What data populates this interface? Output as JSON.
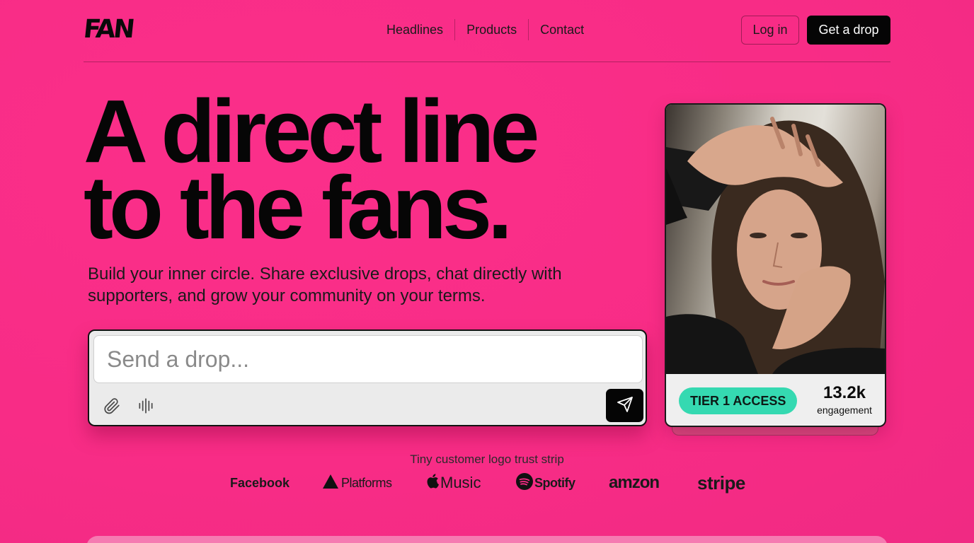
{
  "brand": {
    "logo_text": "FAN"
  },
  "nav": {
    "items": [
      {
        "label": "Headlines"
      },
      {
        "label": "Products"
      },
      {
        "label": "Contact"
      }
    ],
    "login_label": "Log in",
    "cta_label": "Get a drop"
  },
  "hero": {
    "headline_line1": "A direct line",
    "headline_line2": "to the fans.",
    "subtext": "Build your inner circle. Share exclusive drops, chat directly with supporters, and grow your community on your terms."
  },
  "composer": {
    "placeholder": "Send a drop...",
    "value": "",
    "icons": [
      "paperclip-icon",
      "waveform-icon",
      "send-icon"
    ]
  },
  "profile_card": {
    "tier_badge": "TIER 1 ACCESS",
    "engagement_value": "13.2k",
    "engagement_label": "engagement"
  },
  "trust_strip": {
    "caption": "Tiny customer logo trust strip",
    "logos": [
      {
        "name": "Facebook",
        "icon": ""
      },
      {
        "name": "Platforms",
        "icon": "triangle-icon"
      },
      {
        "name": "Music",
        "icon": "apple-icon"
      },
      {
        "name": "Spotify",
        "icon": "spotify-icon"
      },
      {
        "name": "amzon",
        "icon": ""
      },
      {
        "name": "stripe",
        "icon": ""
      }
    ]
  },
  "colors": {
    "background": "#f82c86",
    "primary_button": "#050505",
    "tier_badge": "#35d9b1"
  }
}
